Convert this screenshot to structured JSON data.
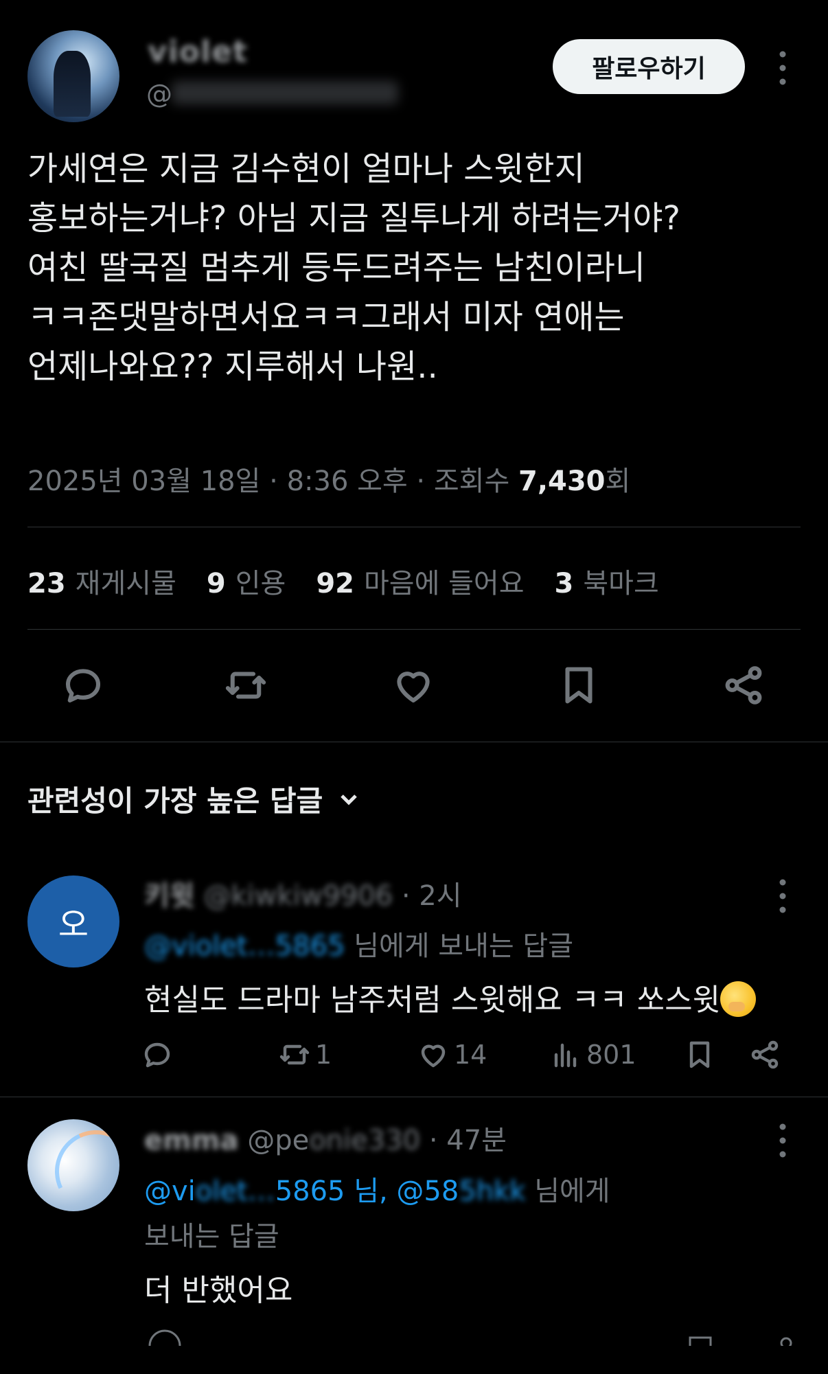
{
  "tweet": {
    "author_name": "violet",
    "handle": "@",
    "follow_label": "팔로우하기",
    "text": "가세연은 지금 김수현이 얼마나 스윗한지\n홍보하는거냐? 아님 지금 질투나게 하려는거야?\n여친 딸국질 멈추게 등두드려주는 남친이라니\nㅋㅋ존댓말하면서요ㅋㅋ그래서 미자 연애는\n언제나와요?? 지루해서 나원..",
    "date": "2025년 03월 18일 · 8:36 오후 · 조회수",
    "views": "7,430",
    "views_suffix": "회"
  },
  "stats": [
    {
      "count": "23",
      "label": "재게시물"
    },
    {
      "count": "9",
      "label": "인용"
    },
    {
      "count": "92",
      "label": "마음에 들어요"
    },
    {
      "count": "3",
      "label": "북마크"
    }
  ],
  "icons": {
    "reply": "reply-icon",
    "repost": "repost-icon",
    "like": "heart-icon",
    "bookmark": "bookmark-icon",
    "share": "share-icon",
    "views": "views-icon",
    "more": "more-vertical-icon",
    "chevron": "chevron-down-icon"
  },
  "colors": {
    "background": "#000000",
    "text_primary": "#e7e9ea",
    "text_secondary": "#71767b",
    "link": "#1d9bf0",
    "follow_button_bg": "#eff3f4"
  },
  "sort": {
    "label": "관련성이 가장 높은 답글"
  },
  "replies": [
    {
      "avatar_letter": "오",
      "name_blurred": "키윗",
      "handle_blurred": "@kiwkiw9906",
      "time": "· 2시",
      "mention": "@violet…5865",
      "mention_suffix": "님에게 보내는 답글",
      "text": "현실도 드라마 남주처럼 스윗해요 ㅋㅋ 쏘스윗",
      "reposts": "1",
      "likes": "14",
      "views": "801"
    },
    {
      "name_blurred": "emma",
      "handle_prefix": "@pe",
      "handle_blurred": "onie330",
      "time": "· 47분",
      "mention": "@vi",
      "mention_blurred": "olet…",
      "mention_mid": "5865 님, @58",
      "mention_blurred_2": "5hkk",
      "mention_suffix": "님에게",
      "mention_line2": "보내는 답글",
      "text": "더 반했어요"
    }
  ]
}
